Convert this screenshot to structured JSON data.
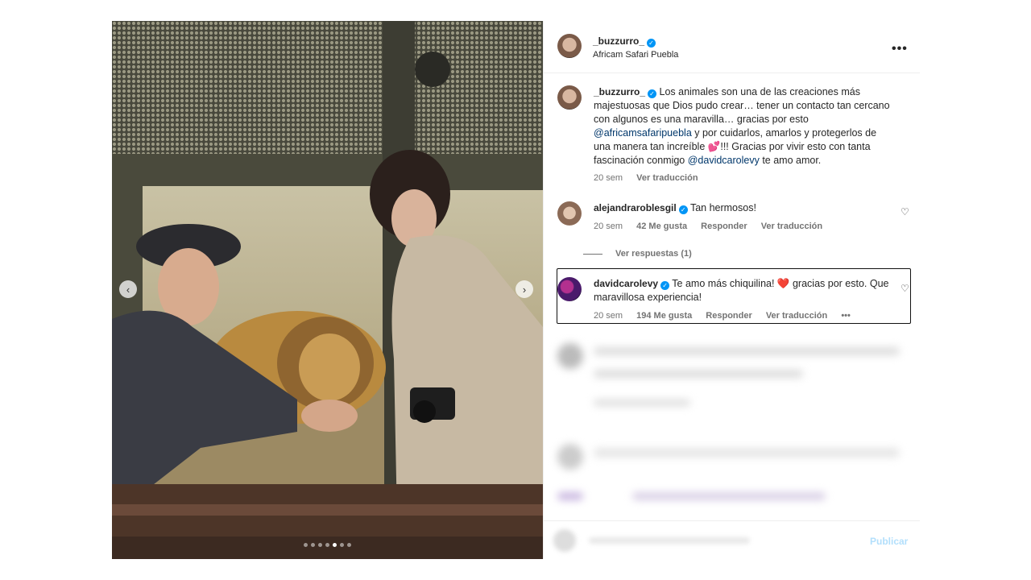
{
  "post": {
    "username": "_buzzurro_",
    "location": "Africam Safari Puebla",
    "carousel": {
      "total_slides": 7,
      "active_slide": 5
    }
  },
  "caption": {
    "username": "_buzzurro_",
    "text_1": "Los animales son una de las creaciones más majestuosas que Dios pudo crear… tener un contacto tan cercano con algunos es una maravilla… gracias por esto ",
    "mention_1": "@africamsafaripuebla",
    "text_2": " y por cuidarlos, amarlos y protegerlos de una manera tan increíble ",
    "emoji": "💕",
    "text_3": "!!! Gracias por vivir esto con tanta fascinación conmigo ",
    "mention_2": "@davidcarolevy",
    "text_4": " te amo amor.",
    "time": "20 sem",
    "translate": "Ver traducción"
  },
  "comments": [
    {
      "username": "alejandraroblesgil",
      "verified": true,
      "text": "Tan hermosos!",
      "time": "20 sem",
      "likes": "42 Me gusta",
      "reply": "Responder",
      "translate": "Ver traducción",
      "view_replies": "Ver respuestas (1)"
    },
    {
      "username": "davidcarolevy",
      "verified": true,
      "text_1": "Te amo más chiquilina! ",
      "emoji": "❤️",
      "text_2": " gracias por esto. Que maravillosa experiencia!",
      "time": "20 sem",
      "likes": "194 Me gusta",
      "reply": "Responder",
      "translate": "Ver traducción",
      "more": "•••"
    }
  ],
  "footer": {
    "publish": "Publicar"
  },
  "icons": {
    "more": "more-options-icon",
    "heart": "heart-icon",
    "verified": "verified-badge-icon",
    "prev": "chevron-left-icon",
    "next": "chevron-right-icon"
  },
  "colors": {
    "link": "#00376b",
    "verified": "#0095f6",
    "meta": "#737373",
    "publish": "#b2dffc",
    "heart_red": "#e0245e"
  }
}
